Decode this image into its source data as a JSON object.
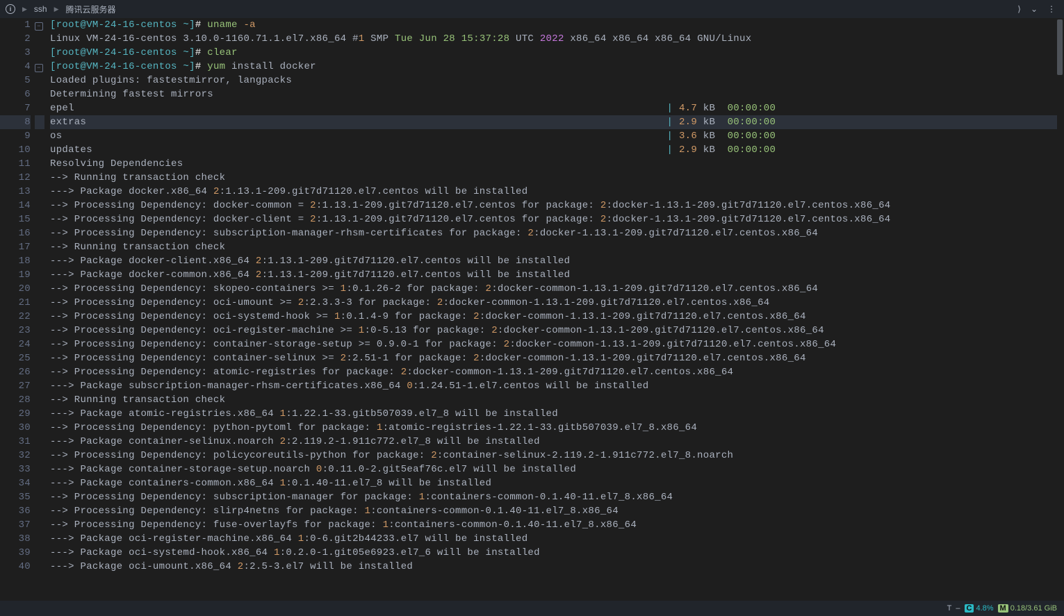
{
  "topbar": {
    "crumb1": "ssh",
    "crumb2": "腾讯云服务器",
    "info_glyph": "i"
  },
  "highlighted_line": 8,
  "fold_markers": {
    "1": "−",
    "4": "−"
  },
  "lines": [
    {
      "n": 1,
      "segments": [
        {
          "t": "[root@VM-24-16-centos ~]",
          "c": "c-teal"
        },
        {
          "t": "# ",
          "c": "c-white"
        },
        {
          "t": "uname ",
          "c": "c-green"
        },
        {
          "t": "-a",
          "c": "c-yellow"
        }
      ]
    },
    {
      "n": 2,
      "segments": [
        {
          "t": "Linux VM-24-16-centos 3.10.0-1160.71.1.el7.x86_64 #",
          "c": "c-grey"
        },
        {
          "t": "1",
          "c": "c-yellow"
        },
        {
          "t": " SMP ",
          "c": "c-grey"
        },
        {
          "t": "Tue Jun 28 15:37:28",
          "c": "c-green"
        },
        {
          "t": " UTC ",
          "c": "c-grey"
        },
        {
          "t": "2022",
          "c": "c-purple"
        },
        {
          "t": " x86_64 x86_64 x86_64 GNU/Linux",
          "c": "c-grey"
        }
      ]
    },
    {
      "n": 3,
      "segments": [
        {
          "t": "[root@VM-24-16-centos ~]",
          "c": "c-teal"
        },
        {
          "t": "# ",
          "c": "c-white"
        },
        {
          "t": "clear",
          "c": "c-green"
        }
      ]
    },
    {
      "n": 4,
      "segments": [
        {
          "t": "[root@VM-24-16-centos ~]",
          "c": "c-teal"
        },
        {
          "t": "# ",
          "c": "c-white"
        },
        {
          "t": "yum",
          "c": "c-green"
        },
        {
          "t": " install docker",
          "c": "c-grey"
        }
      ]
    },
    {
      "n": 5,
      "segments": [
        {
          "t": "Loaded plugins: fastestmirror, langpacks",
          "c": "c-grey"
        }
      ]
    },
    {
      "n": 6,
      "segments": [
        {
          "t": "Determining fastest mirrors",
          "c": "c-grey"
        }
      ]
    },
    {
      "n": 7,
      "segments": [
        {
          "t": "epel                                                                                                  ",
          "c": "c-grey"
        },
        {
          "t": "| ",
          "c": "c-teal"
        },
        {
          "t": "4.7 ",
          "c": "c-yellow"
        },
        {
          "t": "kB  ",
          "c": "c-grey"
        },
        {
          "t": "00:00:00",
          "c": "c-green"
        }
      ]
    },
    {
      "n": 8,
      "segments": [
        {
          "t": "extras                                                                                                ",
          "c": "c-grey"
        },
        {
          "t": "| ",
          "c": "c-teal"
        },
        {
          "t": "2.9 ",
          "c": "c-yellow"
        },
        {
          "t": "kB  ",
          "c": "c-grey"
        },
        {
          "t": "00:00:00",
          "c": "c-green"
        }
      ]
    },
    {
      "n": 9,
      "segments": [
        {
          "t": "os                                                                                                    ",
          "c": "c-grey"
        },
        {
          "t": "| ",
          "c": "c-teal"
        },
        {
          "t": "3.6 ",
          "c": "c-yellow"
        },
        {
          "t": "kB  ",
          "c": "c-grey"
        },
        {
          "t": "00:00:00",
          "c": "c-green"
        }
      ]
    },
    {
      "n": 10,
      "segments": [
        {
          "t": "updates                                                                                               ",
          "c": "c-grey"
        },
        {
          "t": "| ",
          "c": "c-teal"
        },
        {
          "t": "2.9 ",
          "c": "c-yellow"
        },
        {
          "t": "kB  ",
          "c": "c-grey"
        },
        {
          "t": "00:00:00",
          "c": "c-green"
        }
      ]
    },
    {
      "n": 11,
      "segments": [
        {
          "t": "Resolving Dependencies",
          "c": "c-grey"
        }
      ]
    },
    {
      "n": 12,
      "segments": [
        {
          "t": "--> Running transaction check",
          "c": "c-grey"
        }
      ]
    },
    {
      "n": 13,
      "segments": [
        {
          "t": "---> Package docker.x86_64 ",
          "c": "c-grey"
        },
        {
          "t": "2",
          "c": "c-yellow"
        },
        {
          "t": ":1.13.1-209.git7d71120.el7.centos will be installed",
          "c": "c-grey"
        }
      ]
    },
    {
      "n": 14,
      "segments": [
        {
          "t": "--> Processing Dependency: docker-common = ",
          "c": "c-grey"
        },
        {
          "t": "2",
          "c": "c-yellow"
        },
        {
          "t": ":1.13.1-209.git7d71120.el7.centos for package: ",
          "c": "c-grey"
        },
        {
          "t": "2",
          "c": "c-yellow"
        },
        {
          "t": ":docker-1.13.1-209.git7d71120.el7.centos.x86_64",
          "c": "c-grey"
        }
      ]
    },
    {
      "n": 15,
      "segments": [
        {
          "t": "--> Processing Dependency: docker-client = ",
          "c": "c-grey"
        },
        {
          "t": "2",
          "c": "c-yellow"
        },
        {
          "t": ":1.13.1-209.git7d71120.el7.centos for package: ",
          "c": "c-grey"
        },
        {
          "t": "2",
          "c": "c-yellow"
        },
        {
          "t": ":docker-1.13.1-209.git7d71120.el7.centos.x86_64",
          "c": "c-grey"
        }
      ]
    },
    {
      "n": 16,
      "segments": [
        {
          "t": "--> Processing Dependency: subscription-manager-rhsm-certificates for package: ",
          "c": "c-grey"
        },
        {
          "t": "2",
          "c": "c-yellow"
        },
        {
          "t": ":docker-1.13.1-209.git7d71120.el7.centos.x86_64",
          "c": "c-grey"
        }
      ]
    },
    {
      "n": 17,
      "segments": [
        {
          "t": "--> Running transaction check",
          "c": "c-grey"
        }
      ]
    },
    {
      "n": 18,
      "segments": [
        {
          "t": "---> Package docker-client.x86_64 ",
          "c": "c-grey"
        },
        {
          "t": "2",
          "c": "c-yellow"
        },
        {
          "t": ":1.13.1-209.git7d71120.el7.centos will be installed",
          "c": "c-grey"
        }
      ]
    },
    {
      "n": 19,
      "segments": [
        {
          "t": "---> Package docker-common.x86_64 ",
          "c": "c-grey"
        },
        {
          "t": "2",
          "c": "c-yellow"
        },
        {
          "t": ":1.13.1-209.git7d71120.el7.centos will be installed",
          "c": "c-grey"
        }
      ]
    },
    {
      "n": 20,
      "segments": [
        {
          "t": "--> Processing Dependency: skopeo-containers >= ",
          "c": "c-grey"
        },
        {
          "t": "1",
          "c": "c-yellow"
        },
        {
          "t": ":0.1.26-2 for package: ",
          "c": "c-grey"
        },
        {
          "t": "2",
          "c": "c-yellow"
        },
        {
          "t": ":docker-common-1.13.1-209.git7d71120.el7.centos.x86_64",
          "c": "c-grey"
        }
      ]
    },
    {
      "n": 21,
      "segments": [
        {
          "t": "--> Processing Dependency: oci-umount >= ",
          "c": "c-grey"
        },
        {
          "t": "2",
          "c": "c-yellow"
        },
        {
          "t": ":2.3.3-3 for package: ",
          "c": "c-grey"
        },
        {
          "t": "2",
          "c": "c-yellow"
        },
        {
          "t": ":docker-common-1.13.1-209.git7d71120.el7.centos.x86_64",
          "c": "c-grey"
        }
      ]
    },
    {
      "n": 22,
      "segments": [
        {
          "t": "--> Processing Dependency: oci-systemd-hook >= ",
          "c": "c-grey"
        },
        {
          "t": "1",
          "c": "c-yellow"
        },
        {
          "t": ":0.1.4-9 for package: ",
          "c": "c-grey"
        },
        {
          "t": "2",
          "c": "c-yellow"
        },
        {
          "t": ":docker-common-1.13.1-209.git7d71120.el7.centos.x86_64",
          "c": "c-grey"
        }
      ]
    },
    {
      "n": 23,
      "segments": [
        {
          "t": "--> Processing Dependency: oci-register-machine >= ",
          "c": "c-grey"
        },
        {
          "t": "1",
          "c": "c-yellow"
        },
        {
          "t": ":0-5.13 for package: ",
          "c": "c-grey"
        },
        {
          "t": "2",
          "c": "c-yellow"
        },
        {
          "t": ":docker-common-1.13.1-209.git7d71120.el7.centos.x86_64",
          "c": "c-grey"
        }
      ]
    },
    {
      "n": 24,
      "segments": [
        {
          "t": "--> Processing Dependency: container-storage-setup >= 0.9.0-1 for package: ",
          "c": "c-grey"
        },
        {
          "t": "2",
          "c": "c-yellow"
        },
        {
          "t": ":docker-common-1.13.1-209.git7d71120.el7.centos.x86_64",
          "c": "c-grey"
        }
      ]
    },
    {
      "n": 25,
      "segments": [
        {
          "t": "--> Processing Dependency: container-selinux >= ",
          "c": "c-grey"
        },
        {
          "t": "2",
          "c": "c-yellow"
        },
        {
          "t": ":2.51-1 for package: ",
          "c": "c-grey"
        },
        {
          "t": "2",
          "c": "c-yellow"
        },
        {
          "t": ":docker-common-1.13.1-209.git7d71120.el7.centos.x86_64",
          "c": "c-grey"
        }
      ]
    },
    {
      "n": 26,
      "segments": [
        {
          "t": "--> Processing Dependency: atomic-registries for package: ",
          "c": "c-grey"
        },
        {
          "t": "2",
          "c": "c-yellow"
        },
        {
          "t": ":docker-common-1.13.1-209.git7d71120.el7.centos.x86_64",
          "c": "c-grey"
        }
      ]
    },
    {
      "n": 27,
      "segments": [
        {
          "t": "---> Package subscription-manager-rhsm-certificates.x86_64 ",
          "c": "c-grey"
        },
        {
          "t": "0",
          "c": "c-yellow"
        },
        {
          "t": ":1.24.51-1.el7.centos will be installed",
          "c": "c-grey"
        }
      ]
    },
    {
      "n": 28,
      "segments": [
        {
          "t": "--> Running transaction check",
          "c": "c-grey"
        }
      ]
    },
    {
      "n": 29,
      "segments": [
        {
          "t": "---> Package atomic-registries.x86_64 ",
          "c": "c-grey"
        },
        {
          "t": "1",
          "c": "c-yellow"
        },
        {
          "t": ":1.22.1-33.gitb507039.el7_8 will be installed",
          "c": "c-grey"
        }
      ]
    },
    {
      "n": 30,
      "segments": [
        {
          "t": "--> Processing Dependency: python-pytoml for package: ",
          "c": "c-grey"
        },
        {
          "t": "1",
          "c": "c-yellow"
        },
        {
          "t": ":atomic-registries-1.22.1-33.gitb507039.el7_8.x86_64",
          "c": "c-grey"
        }
      ]
    },
    {
      "n": 31,
      "segments": [
        {
          "t": "---> Package container-selinux.noarch ",
          "c": "c-grey"
        },
        {
          "t": "2",
          "c": "c-yellow"
        },
        {
          "t": ":2.119.2-1.911c772.el7_8 will be installed",
          "c": "c-grey"
        }
      ]
    },
    {
      "n": 32,
      "segments": [
        {
          "t": "--> Processing Dependency: policycoreutils-python for package: ",
          "c": "c-grey"
        },
        {
          "t": "2",
          "c": "c-yellow"
        },
        {
          "t": ":container-selinux-2.119.2-1.911c772.el7_8.noarch",
          "c": "c-grey"
        }
      ]
    },
    {
      "n": 33,
      "segments": [
        {
          "t": "---> Package container-storage-setup.noarch ",
          "c": "c-grey"
        },
        {
          "t": "0",
          "c": "c-yellow"
        },
        {
          "t": ":0.11.0-2.git5eaf76c.el7 will be installed",
          "c": "c-grey"
        }
      ]
    },
    {
      "n": 34,
      "segments": [
        {
          "t": "---> Package containers-common.x86_64 ",
          "c": "c-grey"
        },
        {
          "t": "1",
          "c": "c-yellow"
        },
        {
          "t": ":0.1.40-11.el7_8 will be installed",
          "c": "c-grey"
        }
      ]
    },
    {
      "n": 35,
      "segments": [
        {
          "t": "--> Processing Dependency: subscription-manager for package: ",
          "c": "c-grey"
        },
        {
          "t": "1",
          "c": "c-yellow"
        },
        {
          "t": ":containers-common-0.1.40-11.el7_8.x86_64",
          "c": "c-grey"
        }
      ]
    },
    {
      "n": 36,
      "segments": [
        {
          "t": "--> Processing Dependency: slirp4netns for package: ",
          "c": "c-grey"
        },
        {
          "t": "1",
          "c": "c-yellow"
        },
        {
          "t": ":containers-common-0.1.40-11.el7_8.x86_64",
          "c": "c-grey"
        }
      ]
    },
    {
      "n": 37,
      "segments": [
        {
          "t": "--> Processing Dependency: fuse-overlayfs for package: ",
          "c": "c-grey"
        },
        {
          "t": "1",
          "c": "c-yellow"
        },
        {
          "t": ":containers-common-0.1.40-11.el7_8.x86_64",
          "c": "c-grey"
        }
      ]
    },
    {
      "n": 38,
      "segments": [
        {
          "t": "---> Package oci-register-machine.x86_64 ",
          "c": "c-grey"
        },
        {
          "t": "1",
          "c": "c-yellow"
        },
        {
          "t": ":0-6.git2b44233.el7 will be installed",
          "c": "c-grey"
        }
      ]
    },
    {
      "n": 39,
      "segments": [
        {
          "t": "---> Package oci-systemd-hook.x86_64 ",
          "c": "c-grey"
        },
        {
          "t": "1",
          "c": "c-yellow"
        },
        {
          "t": ":0.2.0-1.git05e6923.el7_6 will be installed",
          "c": "c-grey"
        }
      ]
    },
    {
      "n": 40,
      "segments": [
        {
          "t": "---> Package oci-umount.x86_64 ",
          "c": "c-grey"
        },
        {
          "t": "2",
          "c": "c-yellow"
        },
        {
          "t": ":2.5-3.el7 will be installed",
          "c": "c-grey"
        }
      ]
    }
  ],
  "statusbar": {
    "term_label": "T",
    "sep": "–",
    "cpu_letter": "C",
    "cpu_value": "4.8%",
    "mem_letter": "M",
    "mem_value": "0.18/3.61 GiB"
  }
}
